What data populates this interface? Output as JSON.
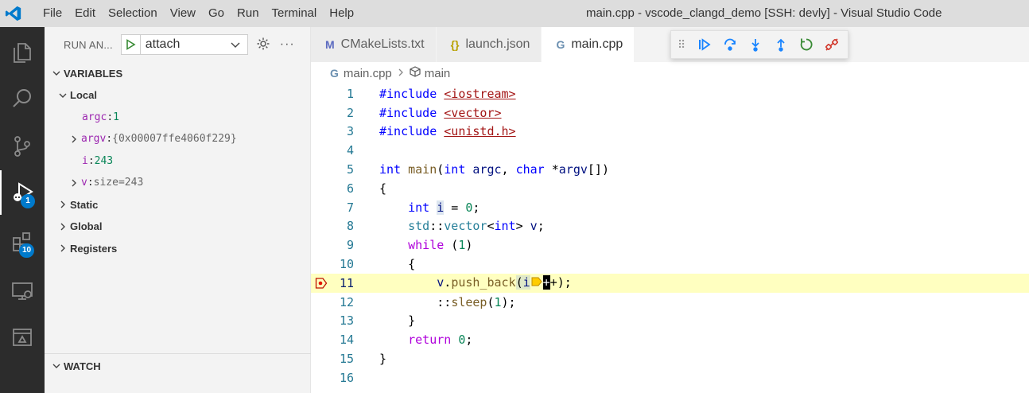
{
  "app": {
    "window_title": "main.cpp - vscode_clangd_demo [SSH: devly] - Visual Studio Code",
    "menu": [
      "File",
      "Edit",
      "Selection",
      "View",
      "Go",
      "Run",
      "Terminal",
      "Help"
    ]
  },
  "activity_bar": {
    "debug_badge": "1",
    "extensions_badge": "10"
  },
  "sidebar": {
    "run_title": "RUN AN...",
    "config_value": "attach",
    "variables_title": "VARIABLES",
    "local_label": "Local",
    "locals": [
      {
        "name": "argc",
        "sep": ": ",
        "value": "1"
      },
      {
        "name": "argv",
        "sep": ": ",
        "value": "{0x00007ffe4060f229}"
      },
      {
        "name": "i",
        "sep": ": ",
        "value": "243"
      },
      {
        "name": "v",
        "sep": ": ",
        "value": "size=243"
      }
    ],
    "static_label": "Static",
    "global_label": "Global",
    "registers_label": "Registers",
    "watch_title": "WATCH"
  },
  "editor": {
    "tabs": [
      {
        "icon": "M",
        "label": "CMakeLists.txt"
      },
      {
        "icon": "{}",
        "label": "launch.json"
      },
      {
        "icon": "G",
        "label": "main.cpp"
      }
    ],
    "breadcrumb": {
      "file": "main.cpp",
      "symbol": "main"
    },
    "line_numbers": [
      "1",
      "2",
      "3",
      "4",
      "5",
      "6",
      "7",
      "8",
      "9",
      "10",
      "11",
      "12",
      "13",
      "14",
      "15",
      "16"
    ],
    "current_line": 11
  },
  "colors": {
    "accent": "#007acc",
    "current_line_bg": "#ffffc0",
    "activity_bar_bg": "#2c2c2c"
  }
}
